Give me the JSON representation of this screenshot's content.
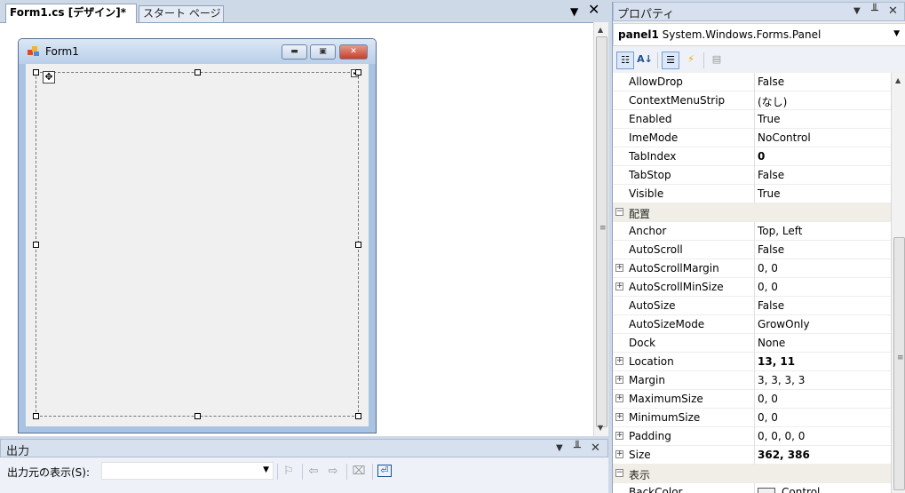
{
  "designer": {
    "tabs": [
      {
        "label": "Form1.cs [デザイン]*"
      },
      {
        "label": "スタート ページ"
      }
    ],
    "dropdown_icon": "chevron-down-icon",
    "close_icon": "close-icon",
    "form": {
      "caption": "Form1",
      "minimize_glyph": "▭",
      "maximize_glyph": "□",
      "close_glyph": "✕"
    }
  },
  "output": {
    "title": "出力",
    "source_label": "出力元の表示(S):",
    "source_value": ""
  },
  "properties": {
    "title": "プロパティ",
    "object_name": "panel1",
    "object_type": "System.Windows.Forms.Panel",
    "rows": [
      {
        "name": "AllowDrop",
        "value": "False"
      },
      {
        "name": "ContextMenuStrip",
        "value": "(なし)"
      },
      {
        "name": "Enabled",
        "value": "True"
      },
      {
        "name": "ImeMode",
        "value": "NoControl"
      },
      {
        "name": "TabIndex",
        "value": "0",
        "bold": true
      },
      {
        "name": "TabStop",
        "value": "False"
      },
      {
        "name": "Visible",
        "value": "True"
      },
      {
        "name": "配置",
        "category": true
      },
      {
        "name": "Anchor",
        "value": "Top, Left"
      },
      {
        "name": "AutoScroll",
        "value": "False"
      },
      {
        "name": "AutoScrollMargin",
        "value": "0, 0",
        "expandable": true
      },
      {
        "name": "AutoScrollMinSize",
        "value": "0, 0",
        "expandable": true
      },
      {
        "name": "AutoSize",
        "value": "False"
      },
      {
        "name": "AutoSizeMode",
        "value": "GrowOnly"
      },
      {
        "name": "Dock",
        "value": "None"
      },
      {
        "name": "Location",
        "value": "13, 11",
        "bold": true,
        "expandable": true
      },
      {
        "name": "Margin",
        "value": "3, 3, 3, 3",
        "expandable": true
      },
      {
        "name": "MaximumSize",
        "value": "0, 0",
        "expandable": true
      },
      {
        "name": "MinimumSize",
        "value": "0, 0",
        "expandable": true
      },
      {
        "name": "Padding",
        "value": "0, 0, 0, 0",
        "expandable": true
      },
      {
        "name": "Size",
        "value": "362, 386",
        "bold": true,
        "expandable": true
      },
      {
        "name": "表示",
        "category": true
      },
      {
        "name": "BackColor",
        "value": "Control",
        "swatch": "#f0f0f0"
      }
    ]
  }
}
